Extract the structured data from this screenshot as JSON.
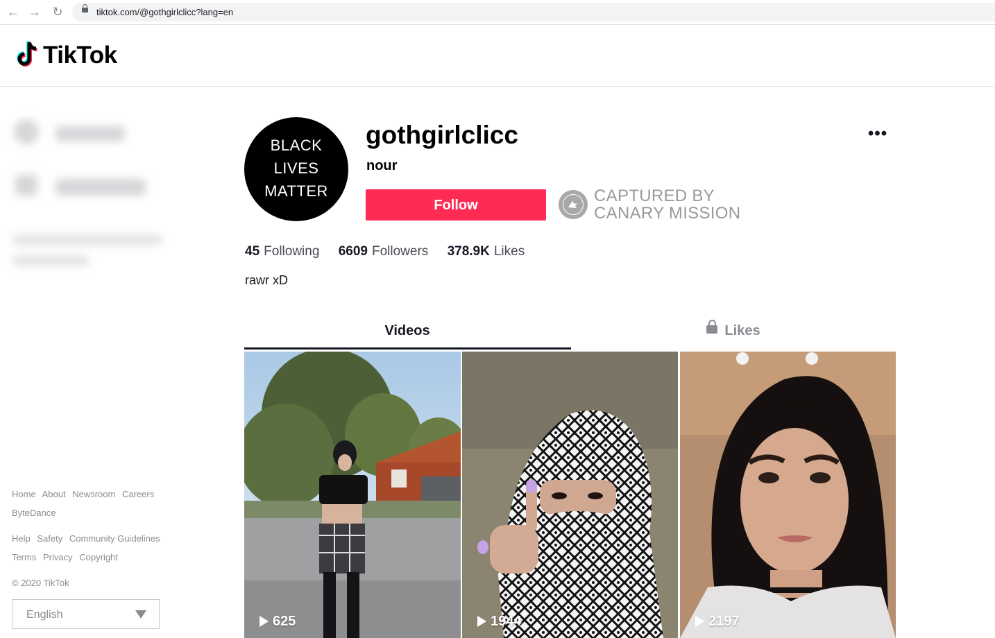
{
  "browser": {
    "url": "tiktok.com/@gothgirlclicc?lang=en"
  },
  "header": {
    "logo_text": "TikTok"
  },
  "sidebar": {
    "footer_links_row1": [
      "Home",
      "About",
      "Newsroom",
      "Careers"
    ],
    "footer_links_row2": [
      "ByteDance"
    ],
    "footer_links_row3": [
      "Help",
      "Safety",
      "Community Guidelines"
    ],
    "footer_links_row4": [
      "Terms",
      "Privacy",
      "Copyright"
    ],
    "copyright": "© 2020 TikTok",
    "language": "English"
  },
  "profile": {
    "avatar_lines": [
      "BLACK",
      "LIVES",
      "MATTER"
    ],
    "username": "gothgirlclicc",
    "nickname": "nour",
    "follow_label": "Follow",
    "more_label": "•••",
    "stamp_line1": "CAPTURED BY",
    "stamp_line2": "CANARY MISSION",
    "stats": [
      {
        "value": "45",
        "label": "Following"
      },
      {
        "value": "6609",
        "label": "Followers"
      },
      {
        "value": "378.9K",
        "label": "Likes"
      }
    ],
    "bio": "rawr xD"
  },
  "tabs": {
    "videos": "Videos",
    "likes": "Likes"
  },
  "videos": [
    {
      "plays": "625"
    },
    {
      "plays": "1944"
    },
    {
      "plays": "2197"
    }
  ]
}
